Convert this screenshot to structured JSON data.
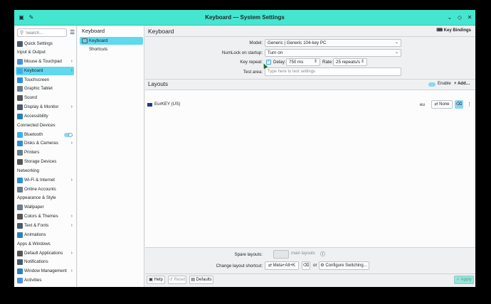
{
  "window": {
    "title": "Keyboard — System Settings"
  },
  "sidebar": {
    "search_placeholder": "Search…",
    "quick_settings": "Quick Settings",
    "sections": [
      {
        "header": "Input & Output",
        "items": [
          {
            "label": "Mouse & Touchpad",
            "chevron": true
          },
          {
            "label": "Keyboard",
            "chevron": true,
            "active": true
          },
          {
            "label": "Touchscreen"
          },
          {
            "label": "Graphic Tablet"
          },
          {
            "label": "Sound"
          },
          {
            "label": "Display & Monitor",
            "chevron": true
          },
          {
            "label": "Accessibility"
          }
        ]
      },
      {
        "header": "Connected Devices",
        "items": [
          {
            "label": "Bluetooth",
            "toggle": true
          },
          {
            "label": "Disks & Cameras",
            "chevron": true
          },
          {
            "label": "Printers"
          },
          {
            "label": "Storage Devices"
          }
        ]
      },
      {
        "header": "Networking",
        "items": [
          {
            "label": "Wi-Fi & Internet",
            "chevron": true
          },
          {
            "label": "Online Accounts"
          }
        ]
      },
      {
        "header": "Appearance & Style",
        "items": [
          {
            "label": "Wallpaper"
          },
          {
            "label": "Colors & Themes",
            "chevron": true
          },
          {
            "label": "Text & Fonts",
            "chevron": true
          },
          {
            "label": "Animations"
          }
        ]
      },
      {
        "header": "Apps & Windows",
        "items": [
          {
            "label": "Default Applications",
            "chevron": true
          },
          {
            "label": "Notifications"
          },
          {
            "label": "Window Management",
            "chevron": true
          },
          {
            "label": "Activities"
          }
        ]
      }
    ]
  },
  "subpanel": {
    "title": "Keyboard",
    "items": [
      "Keyboard",
      "Shortcuts"
    ]
  },
  "main": {
    "title": "Keyboard",
    "key_bindings": "Key Bindings",
    "model_label": "Model:",
    "model_value": "Generic | Generic 104-key PC",
    "numlock_label": "NumLock on startup:",
    "numlock_value": "Turn on",
    "repeat_label": "Key repeat:",
    "delay_label": "Delay:",
    "delay_value": "750 ms",
    "rate_label": "Rate:",
    "rate_value": "25 repeats/s",
    "test_label": "Test area:",
    "test_placeholder": "Type here to test settings",
    "layouts_title": "Layouts",
    "enable_label": "Enable",
    "add_label": "Add…",
    "layout_name": "EurKEY (US)",
    "layout_code": "eu",
    "layout_variant": "None",
    "spare_label": "Spare layouts:",
    "spare_unit": "main layouts",
    "shortcut_label": "Change layout shortcut:",
    "shortcut_value": "Meta+Alt+K",
    "or_label": "or",
    "configure_label": "Configure Switching…",
    "help": "Help",
    "reset": "Reset",
    "defaults": "Defaults",
    "apply": "Apply"
  },
  "colors": {
    "titlebar": "#45e6cf",
    "accent": "#5fd8f0"
  }
}
